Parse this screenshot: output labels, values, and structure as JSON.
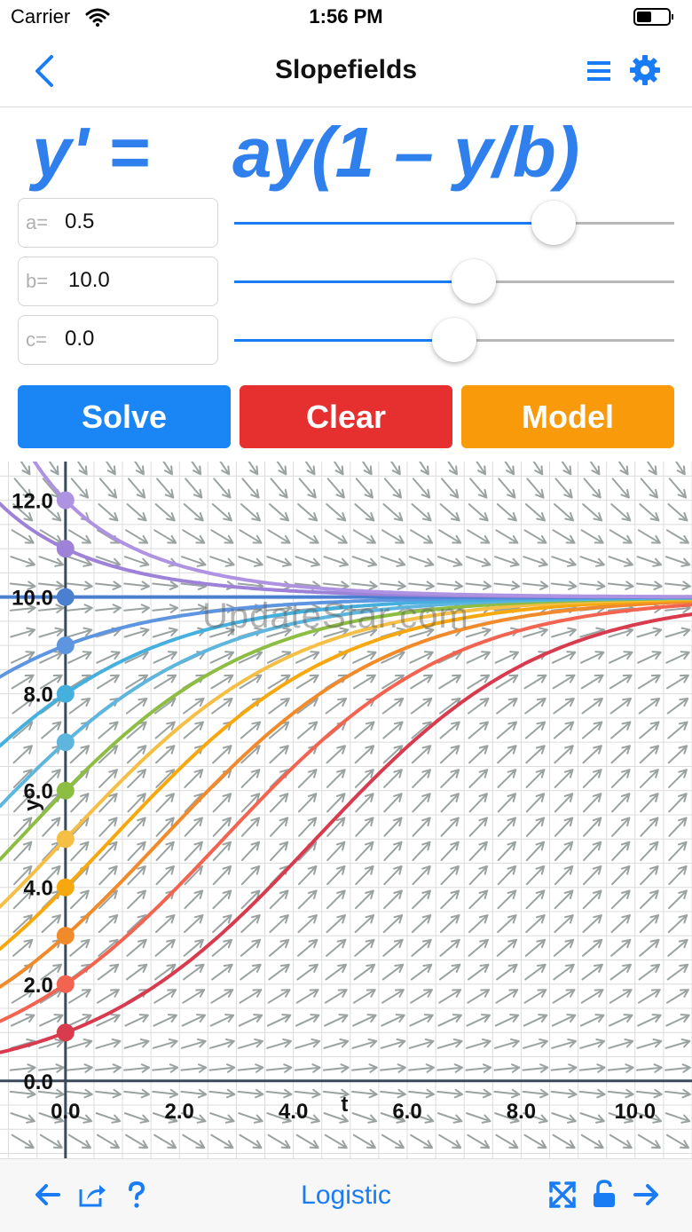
{
  "status": {
    "carrier": "Carrier",
    "time": "1:56 PM"
  },
  "nav": {
    "title": "Slopefields"
  },
  "equation": {
    "lhs": "y' =",
    "rhs": "ay(1 – y/b)"
  },
  "params": [
    {
      "label": "a=",
      "value": "0.5",
      "fraction": 0.725
    },
    {
      "label": "b=",
      "value": "10.0",
      "fraction": 0.545
    },
    {
      "label": "c=",
      "value": "0.0",
      "fraction": 0.5
    }
  ],
  "buttons": {
    "solve": "Solve",
    "clear": "Clear",
    "model": "Model"
  },
  "colors": {
    "accent": "#1a7cf5",
    "equation": "#2f80ed",
    "solve": "#1a86f5",
    "clear": "#e63030",
    "model": "#f99a0b"
  },
  "chart_data": {
    "type": "line",
    "xlabel": "t",
    "ylabel": "y",
    "xlim": [
      -1.15,
      11.0
    ],
    "ylim": [
      -1.6,
      12.8
    ],
    "x_ticks": [
      "0.0",
      "2.0",
      "4.0",
      "6.0",
      "8.0",
      "10.0"
    ],
    "y_ticks": [
      "0.0",
      "2.0",
      "4.0",
      "6.0",
      "8.0",
      "10.0",
      "12.0"
    ],
    "grid": true,
    "a": 0.5,
    "b": 10.0,
    "initial_values": [
      1,
      2,
      3,
      4,
      5,
      6,
      7,
      8,
      9,
      10,
      11,
      12
    ],
    "series_colors": [
      "#d83b4e",
      "#f26450",
      "#f18a2b",
      "#f7a80e",
      "#f4bf44",
      "#8ebd44",
      "#5eb5dd",
      "#45b0de",
      "#5e95e0",
      "#4b7fd0",
      "#9d82d8",
      "#af93e3",
      "#d470b0"
    ]
  },
  "watermark": "UpdateStar.com",
  "toolbar": {
    "model_name": "Logistic"
  }
}
